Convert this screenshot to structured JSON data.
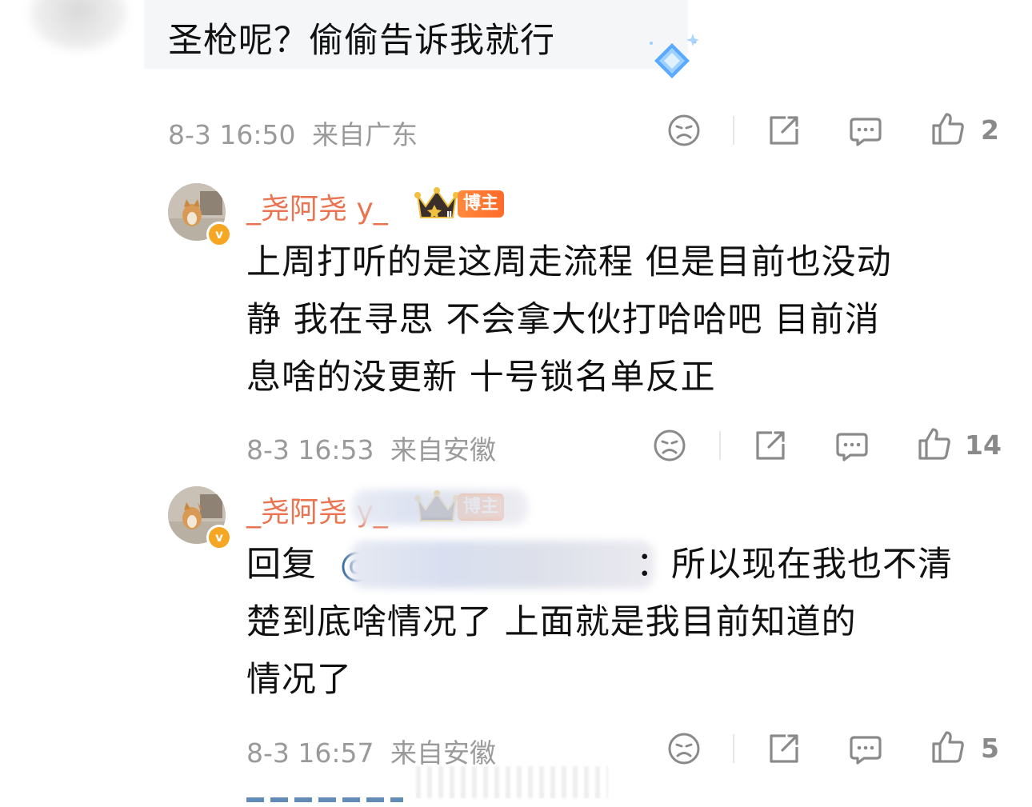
{
  "top_comment": {
    "text": "圣枪呢？偷偷告诉我就行",
    "time": "8-3 16:50",
    "location": "来自广东",
    "likes": "2"
  },
  "replies": [
    {
      "username": "_尧阿尧 y_",
      "badge_level": "Ⅱ",
      "role_badge": "博主",
      "lines": [
        "上周打听的是这周走流程  但是目前也没动",
        "静  我在寻思  不会拿大伙打哈哈吧  目前消",
        "息啥的没更新   十号锁名单反正"
      ],
      "time": "8-3 16:53",
      "location": "来自安徽",
      "likes": "14"
    },
    {
      "username": "_尧阿尧 y_",
      "role_badge": "博主",
      "reply_prefix": "回复",
      "mention_at": "@",
      "lines": [
        "：所以现在我也不清",
        "楚到底啥情况了   上面就是我目前知道的",
        "情况了"
      ],
      "time": "8-3 16:57",
      "location": "来自安徽",
      "likes": "5"
    }
  ],
  "colors": {
    "username": "#eb7350",
    "meta": "#9a9a9a",
    "badge": "#ff7a30",
    "verified": "#f5a623"
  },
  "icons": [
    "sad-face-icon",
    "share-icon",
    "comment-icon",
    "thumbs-up-icon"
  ]
}
